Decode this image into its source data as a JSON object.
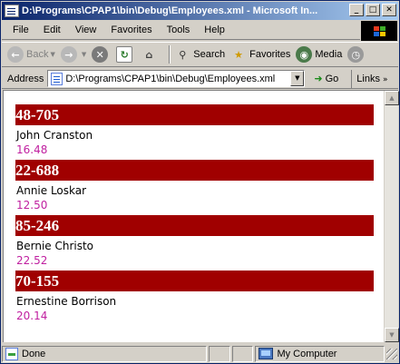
{
  "window": {
    "title": "D:\\Programs\\CPAP1\\bin\\Debug\\Employees.xml - Microsoft In...",
    "controls": [
      "0",
      "1",
      "r"
    ]
  },
  "menu": [
    "File",
    "Edit",
    "View",
    "Favorites",
    "Tools",
    "Help"
  ],
  "toolbar": {
    "back_label": "Back",
    "search_label": "Search",
    "favorites_label": "Favorites",
    "media_label": "Media"
  },
  "address": {
    "label": "Address",
    "value": "D:\\Programs\\CPAP1\\bin\\Debug\\Employees.xml",
    "go_label": "Go",
    "links_label": "Links"
  },
  "employees": [
    {
      "id": "48-705",
      "name": "John Cranston",
      "rate": "16.48"
    },
    {
      "id": "22-688",
      "name": "Annie Loskar",
      "rate": "12.50"
    },
    {
      "id": "85-246",
      "name": "Bernie Christo",
      "rate": "22.52"
    },
    {
      "id": "70-155",
      "name": "Ernestine Borrison",
      "rate": "20.14"
    }
  ],
  "status": {
    "text": "Done",
    "zone": "My Computer"
  },
  "colors": {
    "id_band": "#a00000",
    "rate_text": "#c020a0",
    "title_bar": "#0a246a"
  }
}
